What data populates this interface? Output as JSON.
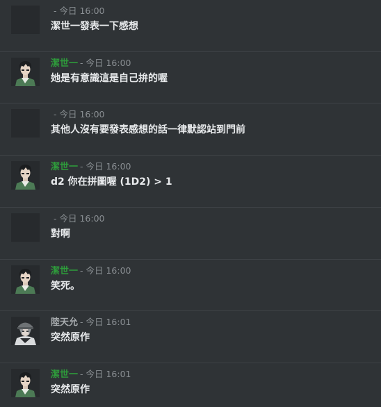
{
  "colors": {
    "background": "#2f3336",
    "divider": "#3e4246",
    "text": "#e8eaec",
    "meta": "#8a8f93",
    "name_green": "#2e9b3b",
    "name_gray": "#a7abae"
  },
  "messages": [
    {
      "name": "",
      "time": "- 今日 16:00",
      "text": "潔世一發表一下感想",
      "avatar": "blank"
    },
    {
      "name": "潔世一",
      "name_color": "#2e9b3b",
      "time": "- 今日 16:00",
      "text": "她是有意識這是自己拚的喔",
      "avatar": "boy-icon"
    },
    {
      "name": "",
      "time": "- 今日 16:00",
      "text": "其他人沒有要發表感想的話一律默認站到門前",
      "avatar": "blank"
    },
    {
      "name": "潔世一",
      "name_color": "#2e9b3b",
      "time": "- 今日 16:00",
      "text": "d2 你在拼圖喔 (1D2) > 1",
      "avatar": "boy-icon"
    },
    {
      "name": "",
      "time": "- 今日 16:00",
      "text": "對啊",
      "avatar": "blank"
    },
    {
      "name": "潔世一",
      "name_color": "#2e9b3b",
      "time": "- 今日 16:00",
      "text": "笑死。",
      "avatar": "boy-icon"
    },
    {
      "name": "陸天允",
      "name_color": "#a7abae",
      "time": "- 今日 16:01",
      "text": "突然原作",
      "avatar": "cap-boy-icon"
    },
    {
      "name": "潔世一",
      "name_color": "#2e9b3b",
      "time": "- 今日 16:01",
      "text": "突然原作",
      "avatar": "boy-icon"
    }
  ]
}
